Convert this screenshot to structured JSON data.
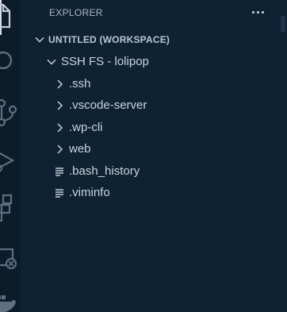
{
  "sidebar": {
    "title": "EXPLORER",
    "more_actions_icon": "ellipsis-icon",
    "workspace": {
      "label": "UNTITLED (WORKSPACE)",
      "expanded": true
    },
    "root_folder": {
      "label": "SSH FS - lolipop",
      "expanded": true
    },
    "items": [
      {
        "label": ".ssh",
        "kind": "folder",
        "expanded": false
      },
      {
        "label": ".vscode-server",
        "kind": "folder",
        "expanded": false
      },
      {
        "label": ".wp-cli",
        "kind": "folder",
        "expanded": false
      },
      {
        "label": "web",
        "kind": "folder",
        "expanded": false
      },
      {
        "label": ".bash_history",
        "kind": "file"
      },
      {
        "label": ".viminfo",
        "kind": "file"
      }
    ]
  },
  "activity_bar": {
    "icons": [
      "explorer-icon",
      "search-icon",
      "source-control-icon",
      "run-debug-icon",
      "extensions-icon",
      "remote-explorer-icon",
      "docker-icon"
    ]
  },
  "colors": {
    "background": "#0f2233",
    "text": "#c9d4de",
    "header_text": "#a9b6c3"
  }
}
